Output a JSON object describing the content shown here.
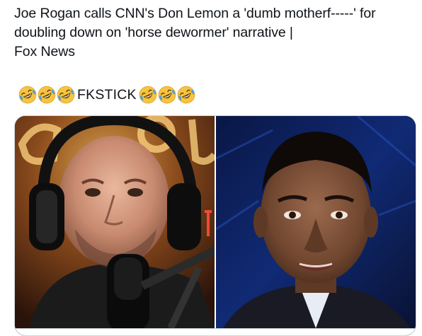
{
  "tweet": {
    "text": "Joe Rogan calls CNN's Don Lemon a 'dumb motherf-----' for doubling down on 'horse dewormer' narrative |\nFox News",
    "emoji_word": "FKSTICK",
    "emoji_name": "rolling-on-the-floor-laughing-icon",
    "emoji_count_left": 3,
    "emoji_count_right": 3
  },
  "media": {
    "left_image": "joe-rogan-podcast-photo",
    "right_image": "don-lemon-cnn-photo"
  },
  "colors": {
    "text": "#0f1419",
    "border": "#cfd9de",
    "emoji_face": "#f6c342",
    "emoji_tear": "#4ba3e3"
  }
}
